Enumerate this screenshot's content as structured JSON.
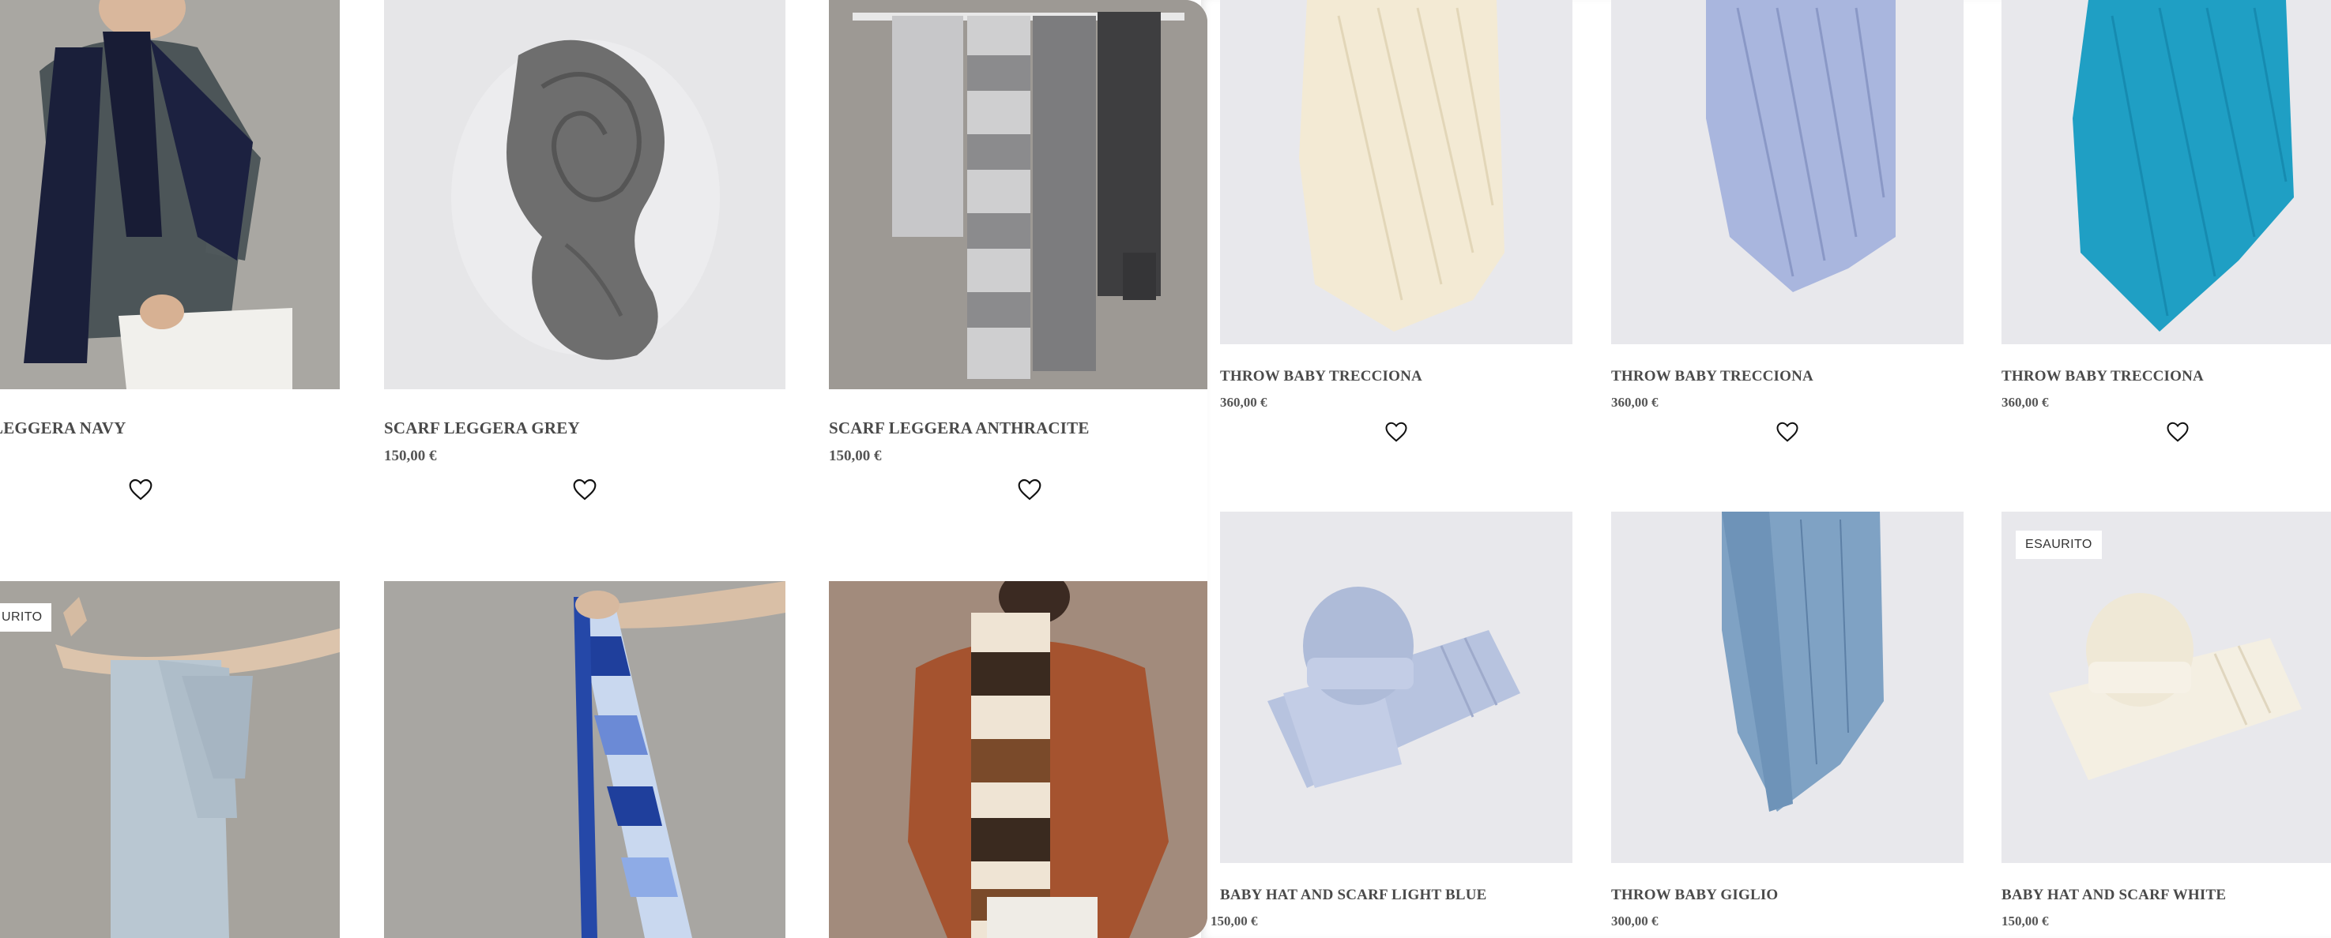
{
  "left_panel": {
    "products": [
      {
        "title": "LEGGERA NAVY",
        "price": ""
      },
      {
        "title": "SCARF LEGGERA GREY",
        "price": "150,00 €"
      },
      {
        "title": "SCARF LEGGERA ANTHRACITE",
        "price": "150,00 €"
      },
      {
        "badge": "URITO"
      },
      {},
      {}
    ]
  },
  "right_panel": {
    "products": [
      {
        "title": "THROW BABY TRECCIONA",
        "price": "360,00 €"
      },
      {
        "title": "THROW BABY TRECCIONA",
        "price": "360,00 €"
      },
      {
        "title": "THROW BABY TRECCIONA",
        "price": "360,00 €"
      },
      {
        "title": "BABY HAT AND SCARF LIGHT BLUE",
        "price": "150,00 €"
      },
      {
        "title": "THROW BABY GIGLIO",
        "price": "300,00 €"
      },
      {
        "title": "BABY HAT AND SCARF WHITE",
        "price": "150,00 €",
        "badge": "ESAURITO"
      }
    ]
  },
  "icons": {
    "wishlist": "heart-outline-icon"
  },
  "colors": {
    "product_bg_warm": "#a8a49d",
    "product_bg_light": "#e9e9ec",
    "navy": "#1a1f3a",
    "teal": "#1f9fc4",
    "royal_blue": "#2548a8",
    "rust": "#a5532f"
  }
}
